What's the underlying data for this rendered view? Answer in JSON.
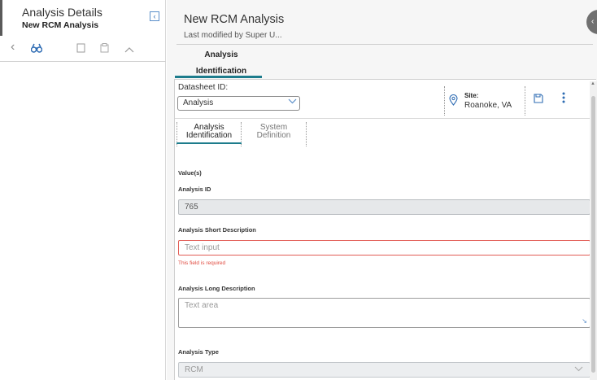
{
  "left": {
    "title": "Analysis Details",
    "subtitle": "New RCM Analysis",
    "collapse_icon": "chevron-left-icon",
    "toolbar": [
      {
        "name": "back-chevron-icon",
        "glyph": "‹"
      },
      {
        "name": "binoculars-icon",
        "glyph": "👓"
      },
      {
        "name": "copy-icon",
        "glyph": "❐"
      },
      {
        "name": "paste-icon",
        "glyph": "▤"
      },
      {
        "name": "chevron-up-icon",
        "glyph": "︿"
      }
    ]
  },
  "header": {
    "title": "New RCM Analysis",
    "subtitle": "Last modified by Super U...",
    "tab_line1": "Analysis",
    "tab_line2": "Identification"
  },
  "card": {
    "datasheet_label": "Datasheet ID:",
    "datasheet_value": "Analysis",
    "site_label": "Site:",
    "site_value": "Roanoke, VA",
    "tabs": [
      {
        "line1": "Analysis",
        "line2": "Identification"
      },
      {
        "line1": "System",
        "line2": "Definition"
      }
    ],
    "values_heading": "Value(s)",
    "fields": {
      "analysis_id_label": "Analysis ID",
      "analysis_id_value": "765",
      "short_desc_label": "Analysis Short Description",
      "short_desc_placeholder": "Text input",
      "short_desc_error": "This field is required",
      "long_desc_label": "Analysis Long Description",
      "long_desc_placeholder": "Text area",
      "type_label": "Analysis Type",
      "type_value": "RCM"
    }
  },
  "colors": {
    "accent_teal": "#1d7c8c",
    "error_red": "#e25c55",
    "link_blue": "#2d6bb3"
  }
}
